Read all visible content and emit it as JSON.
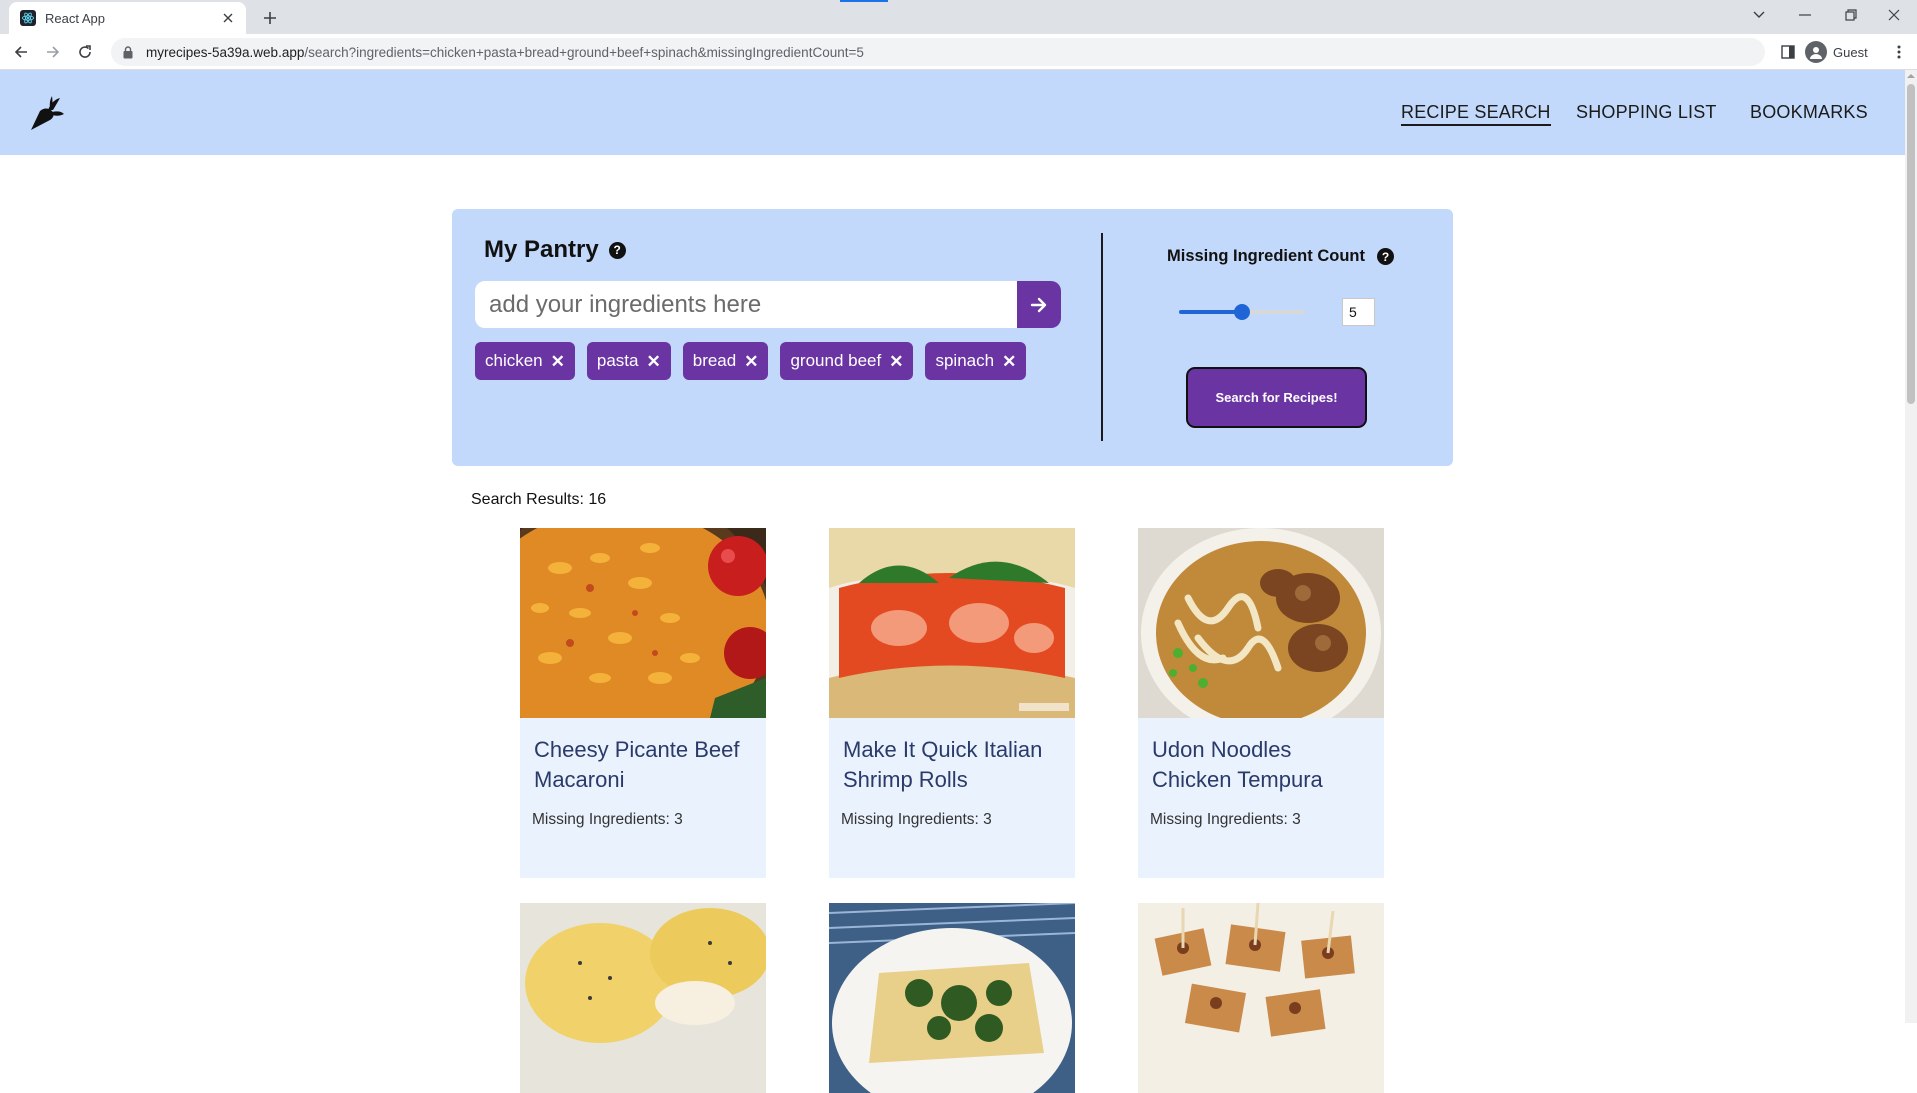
{
  "browser": {
    "tab_title": "React App",
    "url_host": "myrecipes-5a39a.web.app",
    "url_path": "/search?ingredients=chicken+pasta+bread+ground+beef+spinach&missingIngredientCount=5",
    "profile_label": "Guest"
  },
  "header": {
    "logo": "carrot-logo-icon",
    "nav": [
      {
        "label": "RECIPE SEARCH",
        "active": true
      },
      {
        "label": "SHOPPING LIST",
        "active": false
      },
      {
        "label": "BOOKMARKS",
        "active": false
      }
    ]
  },
  "pantry": {
    "title": "My Pantry",
    "help": "?",
    "input_placeholder": "add your ingredients here",
    "ingredients": [
      "chicken",
      "pasta",
      "bread",
      "ground beef",
      "spinach"
    ],
    "chip_remove": "✕"
  },
  "missing": {
    "title": "Missing Ingredient Count",
    "help": "?",
    "value": "5",
    "slider_fraction": 0.5,
    "search_button": "Search for Recipes!"
  },
  "results": {
    "count_label": "Search Results: 16",
    "cards": [
      {
        "title": "Cheesy Picante Beef Macaroni",
        "missing": "Missing Ingredients: 3",
        "image": "macaroni-photo"
      },
      {
        "title": "Make It Quick Italian Shrimp Rolls",
        "missing": "Missing Ingredients: 3",
        "image": "shrimp-roll-photo"
      },
      {
        "title": "Udon Noodles Chicken Tempura",
        "missing": "Missing Ingredients: 3",
        "image": "udon-photo"
      }
    ],
    "partial_cards": [
      {
        "image": "eggs-benedict-photo"
      },
      {
        "image": "spinach-quiche-photo"
      },
      {
        "image": "appetizer-bites-photo"
      }
    ]
  },
  "colors": {
    "header_bg": "#c3d9fb",
    "accent_purple": "#6a34a3",
    "card_bg": "#eaf2fd",
    "slider_blue": "#2065d6"
  }
}
